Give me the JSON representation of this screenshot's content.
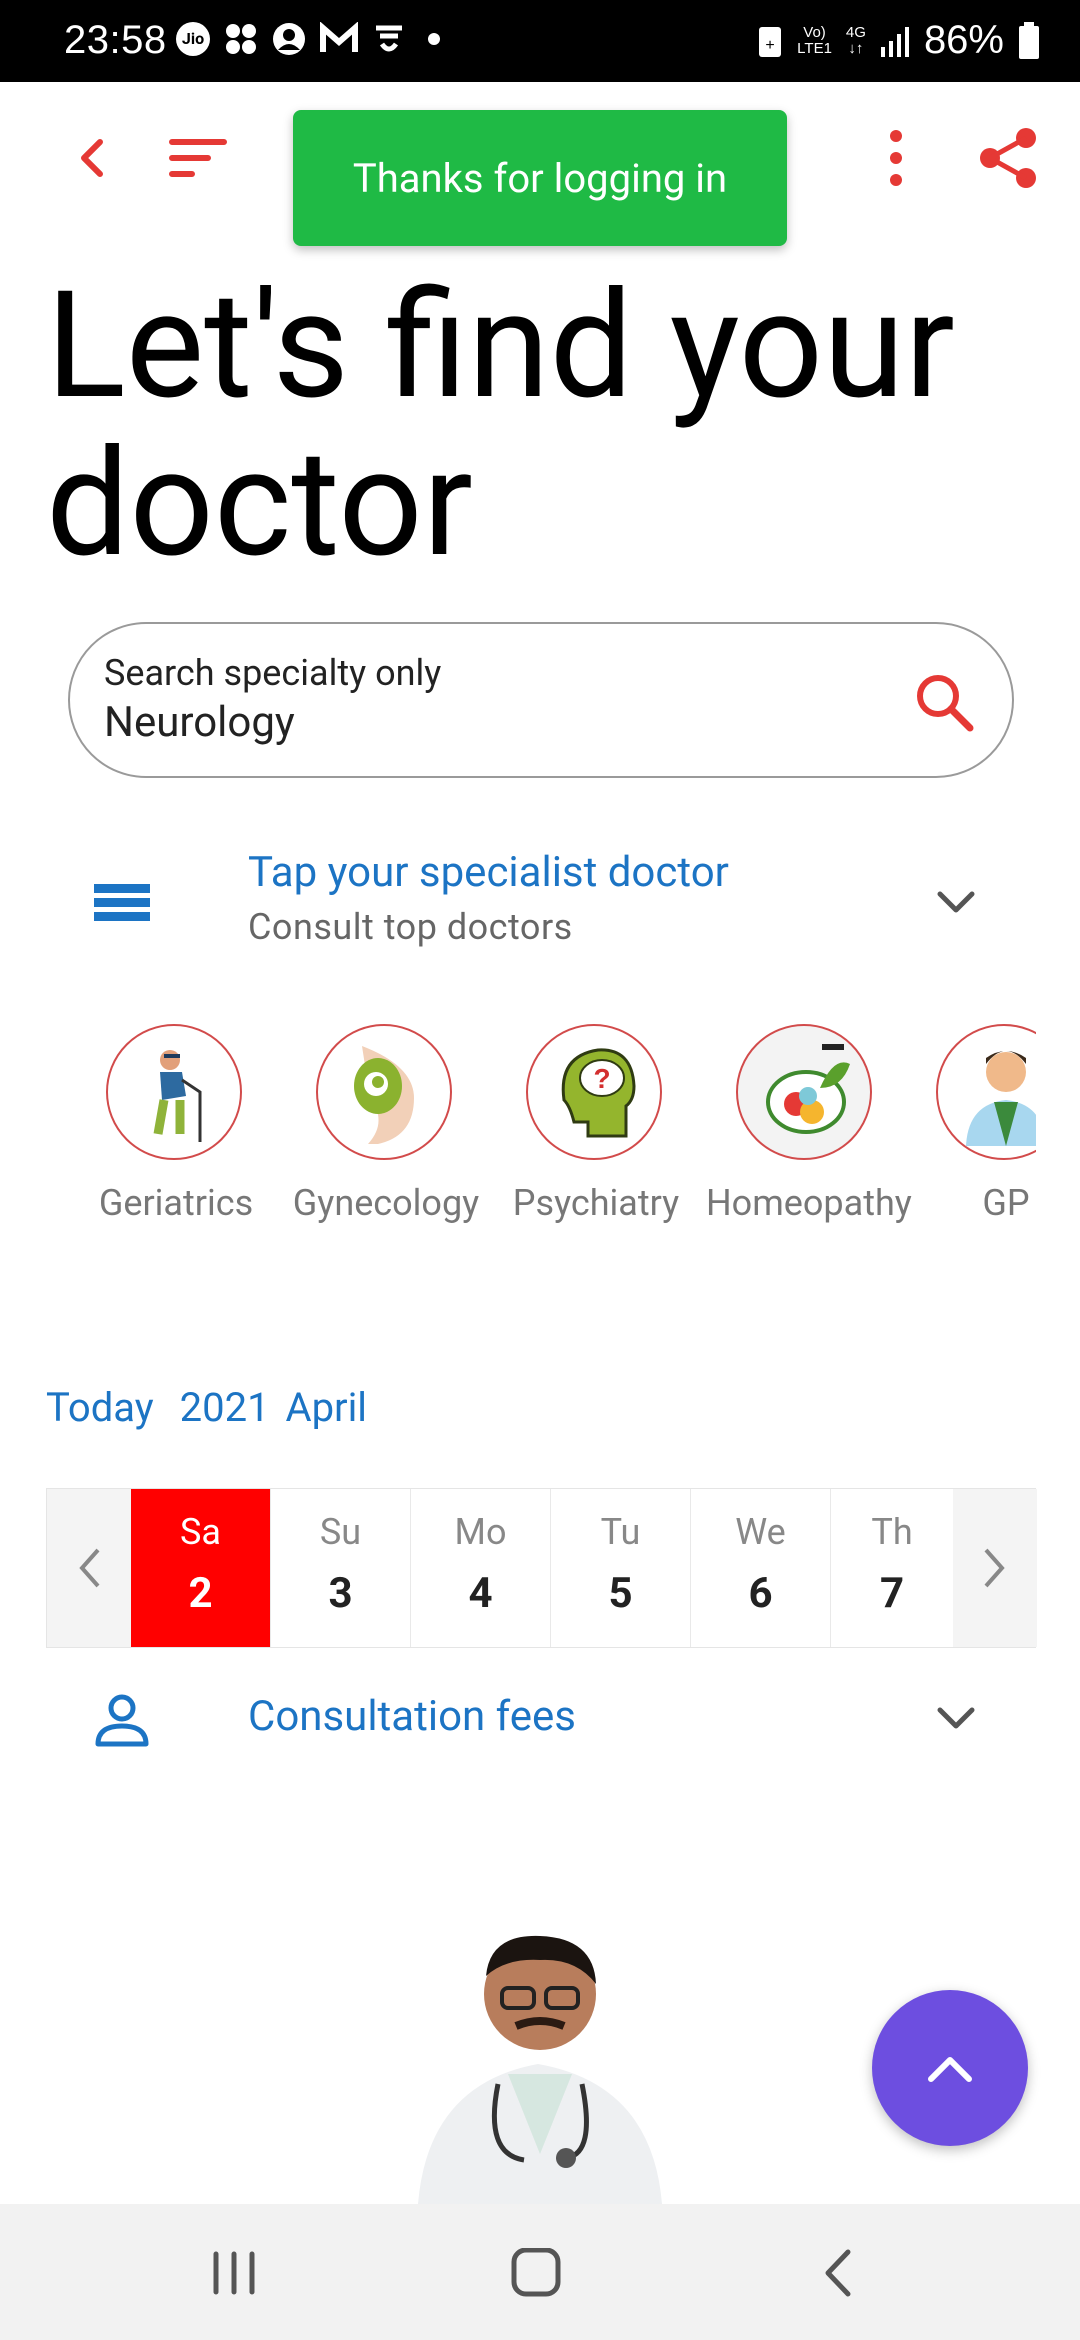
{
  "status_bar": {
    "time": "23:58",
    "network_label_top": "Vo)",
    "network_label_bottom": "LTE1",
    "network_type": "4G",
    "battery": "86%"
  },
  "toast": {
    "message": "Thanks for logging in"
  },
  "page": {
    "title": "Let's find your doctor"
  },
  "search": {
    "label": "Search specialty only",
    "value": "Neurology"
  },
  "specialist_section": {
    "title": "Tap your specialist doctor",
    "subtitle": "Consult top doctors"
  },
  "specialties": [
    {
      "name": "Geriatrics",
      "icon": "elderly-person-icon"
    },
    {
      "name": "Gynecology",
      "icon": "pregnancy-icon"
    },
    {
      "name": "Psychiatry",
      "icon": "head-question-icon"
    },
    {
      "name": "Homeopathy",
      "icon": "herbs-icon"
    },
    {
      "name": "GP",
      "icon": "doctor-icon"
    }
  ],
  "date_header": {
    "today_label": "Today",
    "month_label": "2021 April"
  },
  "calendar": {
    "days": [
      {
        "name": "Sa",
        "date": "2",
        "selected": true
      },
      {
        "name": "Su",
        "date": "3",
        "selected": false
      },
      {
        "name": "Mo",
        "date": "4",
        "selected": false
      },
      {
        "name": "Tu",
        "date": "5",
        "selected": false
      },
      {
        "name": "We",
        "date": "6",
        "selected": false
      },
      {
        "name": "Th",
        "date": "7",
        "selected": false
      }
    ]
  },
  "fees_section": {
    "title": "Consultation fees"
  },
  "colors": {
    "accent_red": "#e53935",
    "link_blue": "#1c74c4",
    "toast_green": "#1fba45",
    "fab_purple": "#6d4ee0",
    "selected_day": "#ff0000"
  }
}
